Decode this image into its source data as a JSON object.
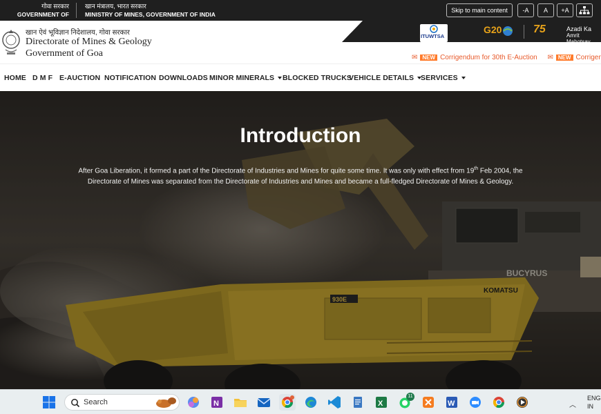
{
  "gov_bar": {
    "left_hindi": "गोवा सरकार",
    "left_english": "GOVERNMENT OF GOA",
    "right_hindi": "खान मंत्रालय, भारत सरकार",
    "right_english": "MINISTRY OF MINES, GOVERNMENT OF INDIA",
    "skip_label": "Skip to main content",
    "font_smaller": "-A",
    "font_normal": "A",
    "font_larger": "+A"
  },
  "header": {
    "dept_hindi": "खान ऐवं भूविज्ञान निदेशालय, गोवा सरकार",
    "dept_english": "Directorate of Mines & Geology",
    "dept_gov": "Government of Goa",
    "itu_label": "ITUWTSA",
    "g20_label": "G20",
    "azadi_num": "75",
    "azadi_line1": "Azadi Ka",
    "azadi_line2": "Amrit Mahotsav"
  },
  "ticker": {
    "new_badge": "NEW",
    "item1": "Corrigendum for 30th E-Auction"
  },
  "nav": {
    "items": [
      {
        "label": "HOME"
      },
      {
        "label": "D M F"
      },
      {
        "label": "E-AUCTION"
      },
      {
        "label": "NOTIFICATION"
      },
      {
        "label": "DOWNLOADS"
      },
      {
        "label": "MINOR MINERALS"
      },
      {
        "label": "BLOCKED TRUCKS"
      },
      {
        "label": "VEHICLE DETAILS"
      },
      {
        "label": "SERVICES"
      }
    ]
  },
  "hero": {
    "title": "Introduction",
    "text_before_sup": "After Goa Liberation, it formed a part of the Directorate of Industries and Mines for quite some time. It was only with effect from 19",
    "sup": "th",
    "text_after_sup": " Feb 2004, the Directorate of Mines was separated from the Directorate of Industries and Mines and became a full-fledged Directorate of Mines & Geology.",
    "machine_label": "KOMATSU",
    "truck_model": "930E",
    "shovel_label": "BUCYRUS"
  },
  "taskbar": {
    "search_placeholder": "Search",
    "lang_line1": "ENG",
    "lang_line2": "IN",
    "whatsapp_badge": "11"
  },
  "colors": {
    "gov_bar_bg": "#1f1f1f",
    "ticker_orange": "#e85a2b",
    "new_badge_bg": "#ff7b2b",
    "taskbar_bg": "#e9eef0"
  }
}
